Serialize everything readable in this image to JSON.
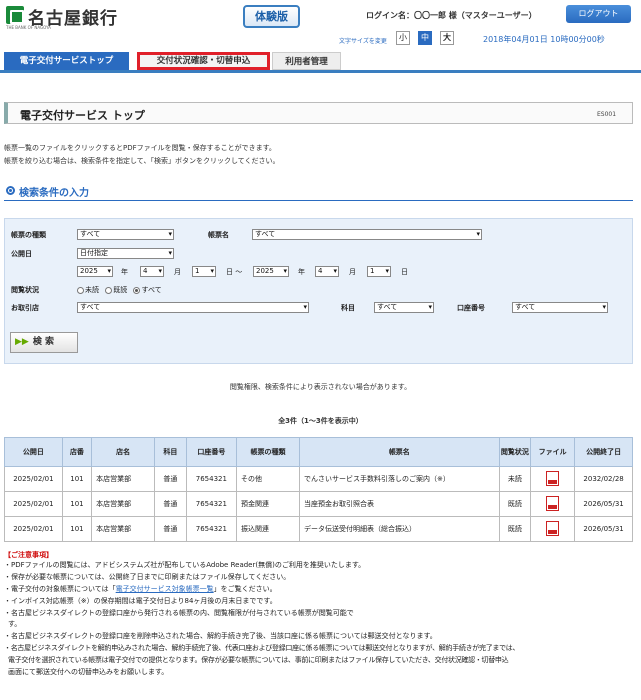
{
  "header": {
    "bank_name": "名古屋銀行",
    "bank_sub": "THE BANK OF NAGOYA",
    "trial_badge": "体験版",
    "login_text": "ログイン名：〇〇一郎 様（マスターユーザー）",
    "logout_label": "ログアウト",
    "font_size_label": "文字サイズを変更",
    "font_sizes": [
      "小",
      "中",
      "大"
    ],
    "datetime": "2018年04月01日 10時00分00秒",
    "brand_color": "#2a6bc0"
  },
  "tabs": [
    "電子交付サービストップ",
    "交付状況確認・切替申込",
    "利用者管理"
  ],
  "page": {
    "title": "電子交付サービス トップ",
    "screen_id": "ES001",
    "desc1": "帳票一覧のファイルをクリックするとPDFファイルを閲覧・保存することができます。",
    "desc2": "帳票を絞り込む場合は、検索条件を指定して、「検索」ボタンをクリックしてください。"
  },
  "search": {
    "section_title": "検索条件の入力",
    "labels": {
      "type": "帳票の種類",
      "name": "帳票名",
      "date": "公開日",
      "status": "閲覧状況",
      "branch": "お取引店",
      "subject": "科目",
      "account": "口座番号"
    },
    "values": {
      "type": "すべて",
      "name": "すべて",
      "date_mode": "日付指定",
      "from_year": "2025",
      "from_month": "4",
      "from_day": "1",
      "to_year": "2025",
      "to_month": "4",
      "to_day": "1",
      "branch": "すべて",
      "subject": "すべて",
      "account": "すべて"
    },
    "units": {
      "year": "年",
      "month": "月",
      "day": "日",
      "tilde": "日 ～"
    },
    "status_options": [
      "未読",
      "既読",
      "すべて"
    ],
    "status_selected": "すべて",
    "button_label": "検 索"
  },
  "note": "閲覧権限、検索条件により表示されない場合があります。",
  "count": "全3件（1～3件を表示中）",
  "table": {
    "headers": [
      "公開日",
      "店番",
      "店名",
      "科目",
      "口座番号",
      "帳票の種類",
      "帳票名",
      "閲覧状況",
      "ファイル",
      "公開終了日"
    ],
    "rows": [
      [
        "2025/02/01",
        "101",
        "本店営業部",
        "普通",
        "7654321",
        "その他",
        "でんさいサービス手数料引落しのご案内（※）",
        "未読",
        "",
        "2032/02/28"
      ],
      [
        "2025/02/01",
        "101",
        "本店営業部",
        "普通",
        "7654321",
        "預金関連",
        "当座預金お取引照合表",
        "既読",
        "",
        "2026/05/31"
      ],
      [
        "2025/02/01",
        "101",
        "本店営業部",
        "普通",
        "7654321",
        "振込関連",
        "データ伝送受付明細表（総合振込）",
        "既読",
        "",
        "2026/05/31"
      ]
    ]
  },
  "caution": {
    "title": "【ご注意事項】",
    "lines": [
      "・PDFファイルの閲覧には、アドビシステムズ社が配布しているAdobe Reader(無償)のご利用を推奨いたします。",
      "・保存が必要な帳票については、公開終了日までに印刷またはファイル保存してください。",
      "・電子交付の対象帳票については「",
      "電子交付サービス対象帳票一覧",
      "」をご覧ください。",
      "・インボイス対応帳票（※）の保存期間は電子交付日より84ヶ月後の月末日までです。",
      "・名古屋ビジネスダイレクトの登録口座から発行される帳票の内、閲覧権限が付与されている帳票が閲覧可能で",
      "す。",
      "・名古屋ビジネスダイレクトの登録口座を削除申込された場合、解約手続き完了後、当該口座に係る帳票については郵送交付となります。",
      "・名古屋ビジネスダイレクトを解約申込みされた場合、解約手続完了後、代表口座および登録口座に係る帳票については郵送交付となりますが、解約手続きが完了までは、",
      "電子交付を選択されている帳票は電子交付での提供となります。保存が必要な帳票については、事前に印刷またはファイル保存していただき、交付状況確認・切替申込",
      "画面にて郵送交付への切替申込みをお願いします。"
    ]
  }
}
